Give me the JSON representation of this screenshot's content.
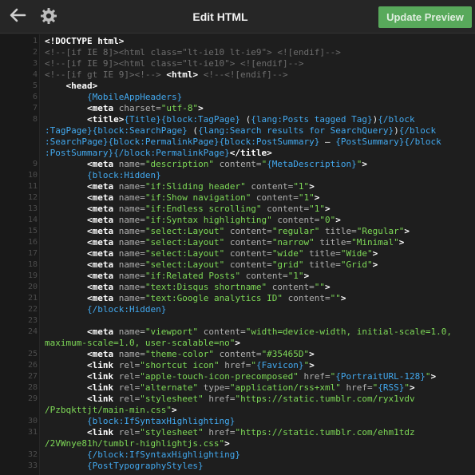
{
  "header": {
    "title": "Edit HTML",
    "update_label": "Update Preview",
    "icons": [
      "arrow-left-icon",
      "gear-icon"
    ],
    "accent_color": "#58a95b"
  },
  "editor": {
    "lines": [
      {
        "n": "1",
        "parts": [
          {
            "c": "tag",
            "t": "<!DOCTYPE html>"
          }
        ]
      },
      {
        "n": "2",
        "parts": [
          {
            "c": "com",
            "t": "<!--[if IE 8]><html class=\"lt-ie10 lt-ie9\"> <![endif]-->"
          }
        ]
      },
      {
        "n": "3",
        "parts": [
          {
            "c": "com",
            "t": "<!--[if IE 9]><html class=\"lt-ie10\"> <![endif]-->"
          }
        ]
      },
      {
        "n": "4",
        "parts": [
          {
            "c": "com",
            "t": "<!--[if gt IE 9]><!--> "
          },
          {
            "c": "tag",
            "t": "<html>"
          },
          {
            "c": "com",
            "t": " <!--<![endif]-->"
          }
        ]
      },
      {
        "n": "5",
        "parts": [
          {
            "c": "txt",
            "t": "    "
          },
          {
            "c": "tag",
            "t": "<head>"
          }
        ]
      },
      {
        "n": "6",
        "parts": [
          {
            "c": "txt",
            "t": "        "
          },
          {
            "c": "blk",
            "t": "{MobileAppHeaders}"
          }
        ]
      },
      {
        "n": "7",
        "parts": [
          {
            "c": "txt",
            "t": "        "
          },
          {
            "c": "tag",
            "t": "<meta"
          },
          {
            "c": "attr",
            "t": " charset="
          },
          {
            "c": "str",
            "t": "\"utf-8\""
          },
          {
            "c": "tag",
            "t": ">"
          }
        ]
      },
      {
        "n": "8",
        "parts": [
          {
            "c": "txt",
            "t": "        "
          },
          {
            "c": "tag",
            "t": "<title>"
          },
          {
            "c": "blk",
            "t": "{Title}{block:TagPage}"
          },
          {
            "c": "txt",
            "t": " ("
          },
          {
            "c": "blk",
            "t": "{lang:Posts tagged Tag}"
          },
          {
            "c": "txt",
            "t": ")"
          },
          {
            "c": "blk",
            "t": "{/block"
          }
        ]
      },
      {
        "n": "",
        "parts": [
          {
            "c": "blk",
            "t": ":TagPage}{block:SearchPage}"
          },
          {
            "c": "txt",
            "t": " ("
          },
          {
            "c": "blk",
            "t": "{lang:Search results for SearchQuery}"
          },
          {
            "c": "txt",
            "t": ")"
          },
          {
            "c": "blk",
            "t": "{/block"
          }
        ]
      },
      {
        "n": "",
        "parts": [
          {
            "c": "blk",
            "t": ":SearchPage}{block:PermalinkPage}{block:PostSummary}"
          },
          {
            "c": "txt",
            "t": " — "
          },
          {
            "c": "blk",
            "t": "{PostSummary}{/block"
          }
        ]
      },
      {
        "n": "",
        "parts": [
          {
            "c": "blk",
            "t": ":PostSummary}{/block:PermalinkPage}"
          },
          {
            "c": "tag",
            "t": "</title>"
          }
        ]
      },
      {
        "n": "9",
        "parts": [
          {
            "c": "txt",
            "t": "        "
          },
          {
            "c": "tag",
            "t": "<meta"
          },
          {
            "c": "attr",
            "t": " name="
          },
          {
            "c": "str",
            "t": "\"description\""
          },
          {
            "c": "attr",
            "t": " content="
          },
          {
            "c": "str",
            "t": "\""
          },
          {
            "c": "blk",
            "t": "{MetaDescription}"
          },
          {
            "c": "str",
            "t": "\""
          },
          {
            "c": "tag",
            "t": ">"
          }
        ]
      },
      {
        "n": "10",
        "parts": [
          {
            "c": "txt",
            "t": "        "
          },
          {
            "c": "blk",
            "t": "{block:Hidden}"
          }
        ]
      },
      {
        "n": "11",
        "parts": [
          {
            "c": "txt",
            "t": "        "
          },
          {
            "c": "tag",
            "t": "<meta"
          },
          {
            "c": "attr",
            "t": " name="
          },
          {
            "c": "str",
            "t": "\"if:Sliding header\""
          },
          {
            "c": "attr",
            "t": " content="
          },
          {
            "c": "str",
            "t": "\"1\""
          },
          {
            "c": "tag",
            "t": ">"
          }
        ]
      },
      {
        "n": "12",
        "parts": [
          {
            "c": "txt",
            "t": "        "
          },
          {
            "c": "tag",
            "t": "<meta"
          },
          {
            "c": "attr",
            "t": " name="
          },
          {
            "c": "str",
            "t": "\"if:Show navigation\""
          },
          {
            "c": "attr",
            "t": " content="
          },
          {
            "c": "str",
            "t": "\"1\""
          },
          {
            "c": "tag",
            "t": ">"
          }
        ]
      },
      {
        "n": "13",
        "parts": [
          {
            "c": "txt",
            "t": "        "
          },
          {
            "c": "tag",
            "t": "<meta"
          },
          {
            "c": "attr",
            "t": " name="
          },
          {
            "c": "str",
            "t": "\"if:Endless scrolling\""
          },
          {
            "c": "attr",
            "t": " content="
          },
          {
            "c": "str",
            "t": "\"1\""
          },
          {
            "c": "tag",
            "t": ">"
          }
        ]
      },
      {
        "n": "14",
        "parts": [
          {
            "c": "txt",
            "t": "        "
          },
          {
            "c": "tag",
            "t": "<meta"
          },
          {
            "c": "attr",
            "t": " name="
          },
          {
            "c": "str",
            "t": "\"if:Syntax highlighting\""
          },
          {
            "c": "attr",
            "t": " content="
          },
          {
            "c": "str",
            "t": "\"0\""
          },
          {
            "c": "tag",
            "t": ">"
          }
        ]
      },
      {
        "n": "15",
        "parts": [
          {
            "c": "txt",
            "t": "        "
          },
          {
            "c": "tag",
            "t": "<meta"
          },
          {
            "c": "attr",
            "t": " name="
          },
          {
            "c": "str",
            "t": "\"select:Layout\""
          },
          {
            "c": "attr",
            "t": " content="
          },
          {
            "c": "str",
            "t": "\"regular\""
          },
          {
            "c": "attr",
            "t": " title="
          },
          {
            "c": "str",
            "t": "\"Regular\""
          },
          {
            "c": "tag",
            "t": ">"
          }
        ]
      },
      {
        "n": "16",
        "parts": [
          {
            "c": "txt",
            "t": "        "
          },
          {
            "c": "tag",
            "t": "<meta"
          },
          {
            "c": "attr",
            "t": " name="
          },
          {
            "c": "str",
            "t": "\"select:Layout\""
          },
          {
            "c": "attr",
            "t": " content="
          },
          {
            "c": "str",
            "t": "\"narrow\""
          },
          {
            "c": "attr",
            "t": " title="
          },
          {
            "c": "str",
            "t": "\"Minimal\""
          },
          {
            "c": "tag",
            "t": ">"
          }
        ]
      },
      {
        "n": "17",
        "parts": [
          {
            "c": "txt",
            "t": "        "
          },
          {
            "c": "tag",
            "t": "<meta"
          },
          {
            "c": "attr",
            "t": " name="
          },
          {
            "c": "str",
            "t": "\"select:Layout\""
          },
          {
            "c": "attr",
            "t": " content="
          },
          {
            "c": "str",
            "t": "\"wide\""
          },
          {
            "c": "attr",
            "t": " title="
          },
          {
            "c": "str",
            "t": "\"Wide\""
          },
          {
            "c": "tag",
            "t": ">"
          }
        ]
      },
      {
        "n": "18",
        "parts": [
          {
            "c": "txt",
            "t": "        "
          },
          {
            "c": "tag",
            "t": "<meta"
          },
          {
            "c": "attr",
            "t": " name="
          },
          {
            "c": "str",
            "t": "\"select:Layout\""
          },
          {
            "c": "attr",
            "t": " content="
          },
          {
            "c": "str",
            "t": "\"grid\""
          },
          {
            "c": "attr",
            "t": " title="
          },
          {
            "c": "str",
            "t": "\"Grid\""
          },
          {
            "c": "tag",
            "t": ">"
          }
        ]
      },
      {
        "n": "19",
        "parts": [
          {
            "c": "txt",
            "t": "        "
          },
          {
            "c": "tag",
            "t": "<meta"
          },
          {
            "c": "attr",
            "t": " name="
          },
          {
            "c": "str",
            "t": "\"if:Related Posts\""
          },
          {
            "c": "attr",
            "t": " content="
          },
          {
            "c": "str",
            "t": "\"1\""
          },
          {
            "c": "tag",
            "t": ">"
          }
        ]
      },
      {
        "n": "20",
        "parts": [
          {
            "c": "txt",
            "t": "        "
          },
          {
            "c": "tag",
            "t": "<meta"
          },
          {
            "c": "attr",
            "t": " name="
          },
          {
            "c": "str",
            "t": "\"text:Disqus shortname\""
          },
          {
            "c": "attr",
            "t": " content="
          },
          {
            "c": "str",
            "t": "\"\""
          },
          {
            "c": "tag",
            "t": ">"
          }
        ]
      },
      {
        "n": "21",
        "parts": [
          {
            "c": "txt",
            "t": "        "
          },
          {
            "c": "tag",
            "t": "<meta"
          },
          {
            "c": "attr",
            "t": " name="
          },
          {
            "c": "str",
            "t": "\"text:Google analytics ID\""
          },
          {
            "c": "attr",
            "t": " content="
          },
          {
            "c": "str",
            "t": "\"\""
          },
          {
            "c": "tag",
            "t": ">"
          }
        ]
      },
      {
        "n": "22",
        "parts": [
          {
            "c": "txt",
            "t": "        "
          },
          {
            "c": "blk",
            "t": "{/block:Hidden}"
          }
        ]
      },
      {
        "n": "23",
        "parts": []
      },
      {
        "n": "24",
        "parts": [
          {
            "c": "txt",
            "t": "        "
          },
          {
            "c": "tag",
            "t": "<meta"
          },
          {
            "c": "attr",
            "t": " name="
          },
          {
            "c": "str",
            "t": "\"viewport\""
          },
          {
            "c": "attr",
            "t": " content="
          },
          {
            "c": "str",
            "t": "\"width=device-width, initial-scale=1.0,"
          }
        ]
      },
      {
        "n": "",
        "parts": [
          {
            "c": "str",
            "t": "maximum-scale=1.0, user-scalable=no\""
          },
          {
            "c": "tag",
            "t": ">"
          }
        ]
      },
      {
        "n": "25",
        "parts": [
          {
            "c": "txt",
            "t": "        "
          },
          {
            "c": "tag",
            "t": "<meta"
          },
          {
            "c": "attr",
            "t": " name="
          },
          {
            "c": "str",
            "t": "\"theme-color\""
          },
          {
            "c": "attr",
            "t": " content="
          },
          {
            "c": "str",
            "t": "\"#35465D\""
          },
          {
            "c": "tag",
            "t": ">"
          }
        ]
      },
      {
        "n": "26",
        "parts": [
          {
            "c": "txt",
            "t": "        "
          },
          {
            "c": "tag",
            "t": "<link"
          },
          {
            "c": "attr",
            "t": " rel="
          },
          {
            "c": "str",
            "t": "\"shortcut icon\""
          },
          {
            "c": "attr",
            "t": " href="
          },
          {
            "c": "str",
            "t": "\""
          },
          {
            "c": "blk",
            "t": "{Favicon}"
          },
          {
            "c": "str",
            "t": "\""
          },
          {
            "c": "tag",
            "t": ">"
          }
        ]
      },
      {
        "n": "27",
        "parts": [
          {
            "c": "txt",
            "t": "        "
          },
          {
            "c": "tag",
            "t": "<link"
          },
          {
            "c": "attr",
            "t": " rel="
          },
          {
            "c": "str",
            "t": "\"apple-touch-icon-precomposed\""
          },
          {
            "c": "attr",
            "t": " href="
          },
          {
            "c": "str",
            "t": "\""
          },
          {
            "c": "blk",
            "t": "{PortraitURL-128}"
          },
          {
            "c": "str",
            "t": "\""
          },
          {
            "c": "tag",
            "t": ">"
          }
        ]
      },
      {
        "n": "28",
        "parts": [
          {
            "c": "txt",
            "t": "        "
          },
          {
            "c": "tag",
            "t": "<link"
          },
          {
            "c": "attr",
            "t": " rel="
          },
          {
            "c": "str",
            "t": "\"alternate\""
          },
          {
            "c": "attr",
            "t": " type="
          },
          {
            "c": "str",
            "t": "\"application/rss+xml\""
          },
          {
            "c": "attr",
            "t": " href="
          },
          {
            "c": "str",
            "t": "\""
          },
          {
            "c": "blk",
            "t": "{RSS}"
          },
          {
            "c": "str",
            "t": "\""
          },
          {
            "c": "tag",
            "t": ">"
          }
        ]
      },
      {
        "n": "29",
        "parts": [
          {
            "c": "txt",
            "t": "        "
          },
          {
            "c": "tag",
            "t": "<link"
          },
          {
            "c": "attr",
            "t": " rel="
          },
          {
            "c": "str",
            "t": "\"stylesheet\""
          },
          {
            "c": "attr",
            "t": " href="
          },
          {
            "c": "str",
            "t": "\"https://static.tumblr.com/ryx1vdv"
          }
        ]
      },
      {
        "n": "",
        "parts": [
          {
            "c": "str",
            "t": "/Pzbqkttjt/main-min.css\""
          },
          {
            "c": "tag",
            "t": ">"
          }
        ]
      },
      {
        "n": "30",
        "parts": [
          {
            "c": "txt",
            "t": "        "
          },
          {
            "c": "blk",
            "t": "{block:IfSyntaxHighlighting}"
          }
        ]
      },
      {
        "n": "31",
        "parts": [
          {
            "c": "txt",
            "t": "        "
          },
          {
            "c": "tag",
            "t": "<link"
          },
          {
            "c": "attr",
            "t": " rel="
          },
          {
            "c": "str",
            "t": "\"stylesheet\""
          },
          {
            "c": "attr",
            "t": " href="
          },
          {
            "c": "str",
            "t": "\"https://static.tumblr.com/ehm1tdz"
          }
        ]
      },
      {
        "n": "",
        "parts": [
          {
            "c": "str",
            "t": "/2VWnye81h/tumblr-highlightjs.css\""
          },
          {
            "c": "tag",
            "t": ">"
          }
        ]
      },
      {
        "n": "32",
        "parts": [
          {
            "c": "txt",
            "t": "        "
          },
          {
            "c": "blk",
            "t": "{/block:IfSyntaxHighlighting}"
          }
        ]
      },
      {
        "n": "33",
        "parts": [
          {
            "c": "txt",
            "t": "        "
          },
          {
            "c": "blk",
            "t": "{PostTypographyStyles}"
          }
        ]
      }
    ]
  }
}
